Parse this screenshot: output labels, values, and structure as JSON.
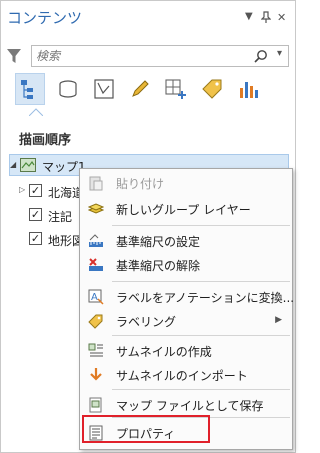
{
  "panel": {
    "title": "コンテンツ",
    "controls": {
      "menu": "▼",
      "pin": "ᵖ",
      "close": "✕"
    }
  },
  "search": {
    "placeholder": "検索"
  },
  "toolbar": {
    "icons": [
      "list-by-drawing-order-icon",
      "list-by-data-source-icon",
      "list-by-selection-icon",
      "list-by-editing-icon",
      "list-by-snapping-icon",
      "list-by-labeling-icon",
      "list-by-charts-icon"
    ]
  },
  "section": {
    "title": "描画順序"
  },
  "tree": {
    "map": "マップ1",
    "layers": [
      {
        "label": "北海道"
      },
      {
        "label": "注記"
      },
      {
        "label": "地形図"
      }
    ]
  },
  "context_menu": {
    "items": [
      {
        "label": "貼り付け",
        "icon": "paste-icon",
        "disabled": true
      },
      {
        "label": "新しいグループ レイヤー",
        "icon": "new-group-layer-icon"
      },
      {
        "label": "基準縮尺の設定",
        "icon": "set-reference-scale-icon"
      },
      {
        "label": "基準縮尺の解除",
        "icon": "clear-reference-scale-icon"
      },
      {
        "label": "ラベルをアノテーションに変換...",
        "icon": "convert-labels-icon"
      },
      {
        "label": "ラベリング",
        "icon": "labeling-icon",
        "submenu": "▶"
      },
      {
        "label": "サムネイルの作成",
        "icon": "create-thumbnail-icon"
      },
      {
        "label": "サムネイルのインポート",
        "icon": "import-thumbnail-icon"
      },
      {
        "label": "マップ ファイルとして保存",
        "icon": "save-map-file-icon"
      },
      {
        "label": "プロパティ",
        "icon": "properties-icon"
      }
    ]
  },
  "colors": {
    "title": "#2f6ab0",
    "selection": "#d6e7f7",
    "highlight_box": "#e0202a"
  }
}
